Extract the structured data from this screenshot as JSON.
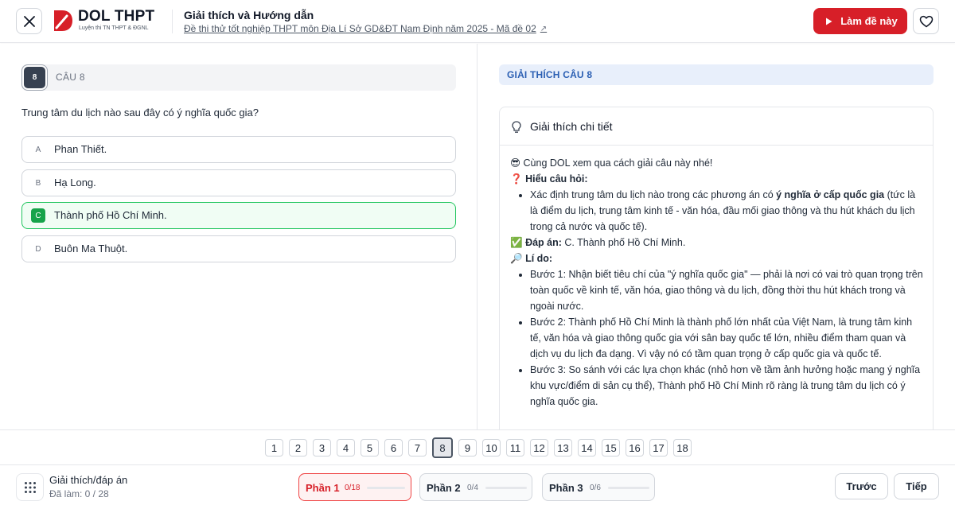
{
  "header": {
    "logo_title": "DOL THPT",
    "logo_subtitle": "Luyện thi TN THPT & ĐGNL",
    "title": "Giải thích và Hướng dẫn",
    "subtitle": "Đề thi thử tốt nghiệp THPT môn Địa Lí Sở GD&ĐT Nam Định năm 2025 - Mã đề 02",
    "ext_icon": "↗",
    "do_test_label": "Làm đề này",
    "brand_color": "#d71f28"
  },
  "question": {
    "number": "8",
    "label": "CÂU 8",
    "text": "Trung tâm du lịch nào sau đây có ý nghĩa quốc gia?",
    "options": [
      {
        "letter": "A",
        "text": "Phan Thiết.",
        "correct": false
      },
      {
        "letter": "B",
        "text": "Hạ Long.",
        "correct": false
      },
      {
        "letter": "C",
        "text": "Thành phố Hồ Chí Minh.",
        "correct": true
      },
      {
        "letter": "D",
        "text": "Buôn Ma Thuột.",
        "correct": false
      }
    ]
  },
  "explanation": {
    "heading": "GIẢI THÍCH CÂU 8",
    "card_title": "Giải thích chi tiết",
    "card_icon": "ǵ",
    "intro_emoji": "😎",
    "intro": "Cùng DOL xem qua cách giải câu này nhé!",
    "understand_emoji": "❓",
    "understand_title": "Hiểu câu hỏi:",
    "understand_pre": "Xác định trung tâm du lịch nào trong các phương án có ",
    "understand_bold": "ý nghĩa ở cấp quốc gia",
    "understand_post": " (tức là là điểm du lịch, trung tâm kinh tế - văn hóa, đầu mối giao thông và thu hút khách du lịch trong cả nước và quốc tế).",
    "answer_emoji": "✅",
    "answer_title": "Đáp án:",
    "answer_text": " C. Thành phố Hồ Chí Minh.",
    "reason_emoji": "🔎",
    "reason_title": "Lí do:",
    "steps": [
      "Bước 1: Nhận biết tiêu chí của \"ý nghĩa quốc gia\" — phải là nơi có vai trò quan trọng trên toàn quốc về kinh tế, văn hóa, giao thông và du lịch, đồng thời thu hút khách trong và ngoài nước.",
      "Bước 2: Thành phố Hồ Chí Minh là thành phố lớn nhất của Việt Nam, là trung tâm kinh tế, văn hóa và giao thông quốc gia với sân bay quốc tế lớn, nhiều điểm tham quan và dịch vụ du lịch đa dạng. Vì vậy nó có tầm quan trọng ở cấp quốc gia và quốc tế.",
      "Bước 3: So sánh với các lựa chọn khác (nhỏ hơn về tầm ảnh hưởng hoặc mang ý nghĩa khu vực/điểm di sản cụ thể), Thành phố Hồ Chí Minh rõ ràng là trung tâm du lịch có ý nghĩa quốc gia."
    ]
  },
  "pages": [
    "1",
    "2",
    "3",
    "4",
    "5",
    "6",
    "7",
    "8",
    "9",
    "10",
    "11",
    "12",
    "13",
    "14",
    "15",
    "16",
    "17",
    "18"
  ],
  "active_page": "8",
  "footer": {
    "title": "Giải thích/đáp án",
    "progress": "Đã làm: 0 / 28",
    "parts": [
      {
        "label": "Phần 1",
        "count": "0/18",
        "progress": 0,
        "active": true
      },
      {
        "label": "Phần 2",
        "count": "0/4",
        "progress": 0,
        "active": false
      },
      {
        "label": "Phần 3",
        "count": "0/6",
        "progress": 0,
        "active": false
      }
    ],
    "prev_label": "Trước",
    "next_label": "Tiếp"
  }
}
